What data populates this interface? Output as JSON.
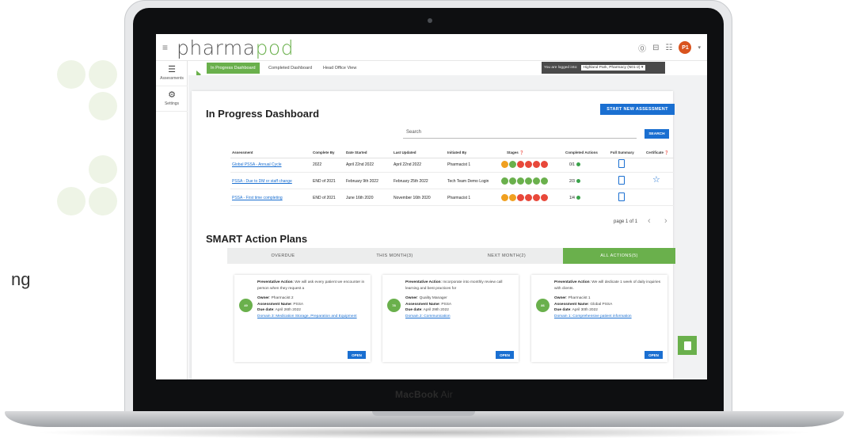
{
  "background": {
    "text_fragment": "ng",
    "accent_color": "#eef4e6"
  },
  "laptop": {
    "model_brand": "MacBook",
    "model_name": "Air"
  },
  "app": {
    "logo_part1": "pharma",
    "logo_part2": "pod",
    "brand_color": "#6ab04c",
    "user_initials": "P1",
    "user_chevron": "▾"
  },
  "sidebar": {
    "items": [
      {
        "label": "Assessments",
        "icon": "list-icon"
      },
      {
        "label": "Settings",
        "icon": "settings-people-icon"
      }
    ]
  },
  "nav": {
    "tabs": [
      {
        "label": "In Progress Dashboard",
        "active": true
      },
      {
        "label": "Completed Dashboard",
        "active": false
      },
      {
        "label": "Head Office View",
        "active": false
      }
    ],
    "login_label": "You are logged into:",
    "login_value": "Highland Park, Pharmacy (N01-2)",
    "login_chevron": "▾"
  },
  "dashboard": {
    "title": "In Progress Dashboard",
    "start_button": "START NEW ASSESSMENT",
    "search_placeholder": "Search",
    "search_button": "SEARCH",
    "columns": [
      "Assessment",
      "Complete By",
      "Date Started",
      "Last Updated",
      "Initiated By",
      "Stages",
      "Completed Actions",
      "Full Summary",
      "Certificate"
    ],
    "rows": [
      {
        "assessment": "Global PSSA - Annual Cycle",
        "complete_by": "2022",
        "date_started": "April 22nd 2022",
        "last_updated": "April 22nd 2022",
        "initiated_by": "Pharmacist 1",
        "stages": [
          "#f0a020",
          "#6ab04c",
          "#e8483a",
          "#e8483a",
          "#e8483a",
          "#e8483a"
        ],
        "completed_actions": "0/1",
        "certificate": false
      },
      {
        "assessment": "PSSA - Due to DM or staff change",
        "complete_by": "END of 2021",
        "date_started": "February 9th 2022",
        "last_updated": "February 25th 2022",
        "initiated_by": "Tech Team Demo Login",
        "stages": [
          "#6ab04c",
          "#6ab04c",
          "#6ab04c",
          "#6ab04c",
          "#6ab04c",
          "#6ab04c"
        ],
        "completed_actions": "2/3",
        "certificate": true
      },
      {
        "assessment": "PSSA - First time completing",
        "complete_by": "END of 2021",
        "date_started": "June 16th 2020",
        "last_updated": "November 16th 2020",
        "initiated_by": "Pharmacist 1",
        "stages": [
          "#f0a020",
          "#f0a020",
          "#e8483a",
          "#e8483a",
          "#e8483a",
          "#e8483a"
        ],
        "completed_actions": "1/4",
        "certificate": false
      }
    ],
    "pager": "page 1 of 1",
    "pager_prev": "‹",
    "pager_next": "›"
  },
  "smart": {
    "title": "SMART Action Plans",
    "tabs": [
      {
        "label": "OVERDUE",
        "active": false
      },
      {
        "label": "THIS MONTH(3)",
        "active": false
      },
      {
        "label": "NEXT MONTH(2)",
        "active": false
      },
      {
        "label": "ALL ACTIONS(5)",
        "active": true
      }
    ],
    "cards": [
      {
        "badge": "49",
        "action_label": "Preventative Action",
        "action_text": ": We will ask every patient we encounter in person when they request a",
        "owner_label": "Owner",
        "owner": ": Pharmacist 2",
        "assessment_label": "Assessment Name",
        "assessment": ": PSSA",
        "due_label": "Due date",
        "due": ": April 26th 2022",
        "domain": "Domain 3: Medication Storage, Preparation and Equipment",
        "open": "OPEN"
      },
      {
        "badge": "78",
        "action_label": "Preventative Action",
        "action_text": ": Incorporate into monthly review call learning and best practices for",
        "owner_label": "Owner",
        "owner": ": Quality Manager",
        "assessment_label": "Assessment Name",
        "assessment": ": PSSA",
        "due_label": "Due date",
        "due": ": April 29th 2022",
        "domain": "Domain 2: Communication",
        "open": "OPEN"
      },
      {
        "badge": "86",
        "action_label": "Preventative Action",
        "action_text": ": We will dedicate 1 week of daily inquiries with clients.",
        "owner_label": "Owner",
        "owner": ": Pharmacist 1",
        "assessment_label": "Assessment Name",
        "assessment": ": Global PSSA",
        "due_label": "Due date",
        "due": ": April 30th 2022",
        "domain": "Domain 1: Comprehensive patient information",
        "open": "OPEN"
      }
    ]
  }
}
